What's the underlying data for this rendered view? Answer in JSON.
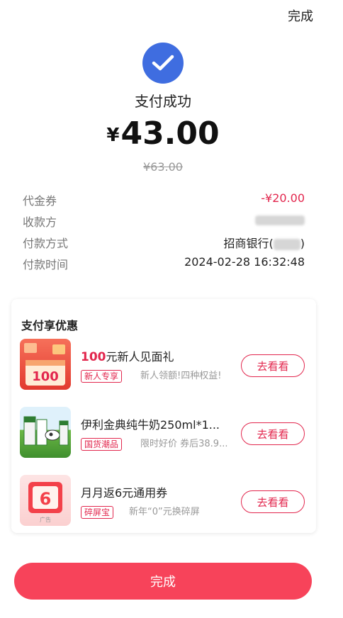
{
  "header": {
    "done_label": "完成"
  },
  "result": {
    "status": "支付成功",
    "currency": "¥",
    "amount": "43.00",
    "original_price": "¥63.00"
  },
  "details": [
    {
      "label": "代金券",
      "value": "-¥20.00",
      "color": "#e2264d"
    },
    {
      "label": "收款方",
      "value": ""
    },
    {
      "label": "付款方式",
      "value": "招商银行(",
      "suffix": ")"
    },
    {
      "label": "付款时间",
      "value": "2024-02-28 16:32:48"
    }
  ],
  "promo": {
    "title": "支付享优惠",
    "items": [
      {
        "title_highlight": "100",
        "title": "元新人见面礼",
        "tag": "新人专享",
        "subtitle": "新人领额!四种权益!",
        "button": "去看看",
        "thumb_icon": "red-gift-icon",
        "thumb_text": "100"
      },
      {
        "title": "伊利金典纯牛奶250ml*1...",
        "tag": "国货潮品",
        "subtitle": "限时好价 券后38.9...",
        "button": "去看看",
        "thumb_icon": "milk-carton-icon"
      },
      {
        "title": "月月返6元通用券",
        "tag": "碎屏宝",
        "subtitle": "新年“0”元换碎屏",
        "button": "去看看",
        "thumb_icon": "coupon-icon",
        "thumb_text": "6",
        "thumb_caption": "广告"
      }
    ]
  },
  "footer": {
    "done_label": "完成"
  },
  "colors": {
    "accent_red": "#e2264d",
    "button_red": "#f7435a",
    "check_blue": "#3f6de0"
  }
}
